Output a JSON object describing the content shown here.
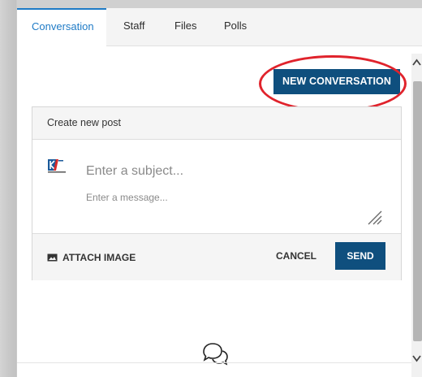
{
  "tabs": [
    {
      "label": "Conversation",
      "active": true
    },
    {
      "label": "Staff",
      "active": false
    },
    {
      "label": "Files",
      "active": false
    },
    {
      "label": "Polls",
      "active": false
    }
  ],
  "new_conversation_label": "NEW CONVERSATION",
  "post": {
    "title": "Create new post",
    "subject_placeholder": "Enter a subject...",
    "message_placeholder": "Enter a message...",
    "attach_label": "ATTACH IMAGE",
    "cancel_label": "CANCEL",
    "send_label": "SEND"
  },
  "icons": {
    "avatar": "company-logo-icon",
    "attach": "image-icon",
    "resize": "resize-handle-icon",
    "empty_state": "chat-bubbles-icon",
    "scroll_up": "chevron-up-icon",
    "scroll_down": "chevron-down-icon"
  },
  "colors": {
    "accent": "#0f4f7e",
    "tab_active": "#1f7bc6",
    "annotation": "#e0232c"
  }
}
